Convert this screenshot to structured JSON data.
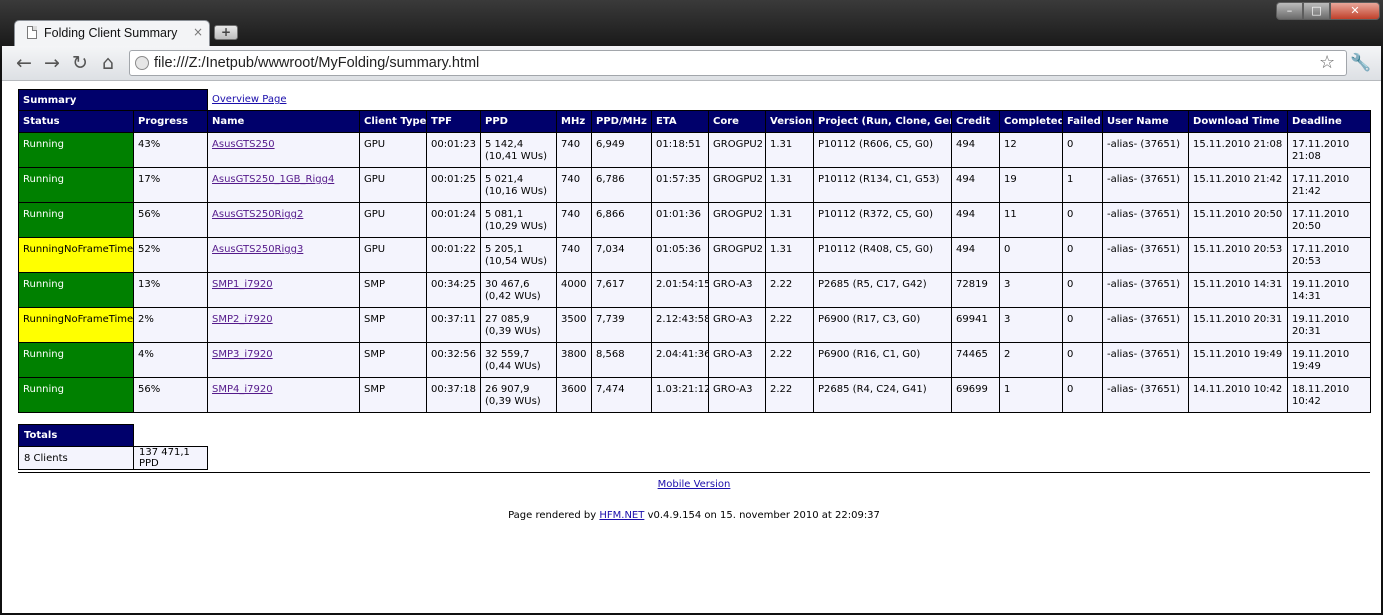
{
  "browser": {
    "tab_title": "Folding Client Summary",
    "tab_close": "×",
    "new_tab": "+",
    "url": "file:///Z:/Inetpub/wwwroot/MyFolding/summary.html",
    "win_min": "–",
    "win_max": "□",
    "win_close": "✕"
  },
  "page": {
    "summary_title": "Summary",
    "overview_link": "Overview Page",
    "columns": [
      "Status",
      "Progress",
      "Name",
      "Client Type",
      "TPF",
      "PPD",
      "MHz",
      "PPD/MHz",
      "ETA",
      "Core",
      "Version",
      "Project (Run, Clone, Gen)",
      "Credit",
      "Completed",
      "Failed",
      "User Name",
      "Download Time",
      "Deadline"
    ],
    "rows": [
      {
        "status": "Running",
        "status_color": "#008000",
        "progress": "43%",
        "name": "AsusGTS250",
        "client_type": "GPU",
        "tpf": "00:01:23",
        "ppd": "5 142,4 (10,41 WUs)",
        "mhz": "740",
        "ppd_mhz": "6,949",
        "eta": "01:18:51",
        "core": "GROGPU2",
        "version": "1.31",
        "project": "P10112 (R606, C5, G0)",
        "credit": "494",
        "completed": "12",
        "failed": "0",
        "user": "-alias- (37651)",
        "download": "15.11.2010 21:08",
        "deadline": "17.11.2010 21:08"
      },
      {
        "status": "Running",
        "status_color": "#008000",
        "progress": "17%",
        "name": "AsusGTS250_1GB_Rigg4",
        "client_type": "GPU",
        "tpf": "00:01:25",
        "ppd": "5 021,4 (10,16 WUs)",
        "mhz": "740",
        "ppd_mhz": "6,786",
        "eta": "01:57:35",
        "core": "GROGPU2",
        "version": "1.31",
        "project": "P10112 (R134, C1, G53)",
        "credit": "494",
        "completed": "19",
        "failed": "1",
        "user": "-alias- (37651)",
        "download": "15.11.2010 21:42",
        "deadline": "17.11.2010 21:42"
      },
      {
        "status": "Running",
        "status_color": "#008000",
        "progress": "56%",
        "name": "AsusGTS250Rigg2",
        "client_type": "GPU",
        "tpf": "00:01:24",
        "ppd": "5 081,1 (10,29 WUs)",
        "mhz": "740",
        "ppd_mhz": "6,866",
        "eta": "01:01:36",
        "core": "GROGPU2",
        "version": "1.31",
        "project": "P10112 (R372, C5, G0)",
        "credit": "494",
        "completed": "11",
        "failed": "0",
        "user": "-alias- (37651)",
        "download": "15.11.2010 20:50",
        "deadline": "17.11.2010 20:50"
      },
      {
        "status": "RunningNoFrameTimes",
        "status_color": "#ffff00",
        "progress": "52%",
        "name": "AsusGTS250Rigg3",
        "client_type": "GPU",
        "tpf": "00:01:22",
        "ppd": "5 205,1 (10,54 WUs)",
        "mhz": "740",
        "ppd_mhz": "7,034",
        "eta": "01:05:36",
        "core": "GROGPU2",
        "version": "1.31",
        "project": "P10112 (R408, C5, G0)",
        "credit": "494",
        "completed": "0",
        "failed": "0",
        "user": "-alias- (37651)",
        "download": "15.11.2010 20:53",
        "deadline": "17.11.2010 20:53"
      },
      {
        "status": "Running",
        "status_color": "#008000",
        "progress": "13%",
        "name": "SMP1_i7920",
        "client_type": "SMP",
        "tpf": "00:34:25",
        "ppd": "30 467,6 (0,42 WUs)",
        "mhz": "4000",
        "ppd_mhz": "7,617",
        "eta": "2.01:54:15",
        "core": "GRO-A3",
        "version": "2.22",
        "project": "P2685 (R5, C17, G42)",
        "credit": "72819",
        "completed": "3",
        "failed": "0",
        "user": "-alias- (37651)",
        "download": "15.11.2010 14:31",
        "deadline": "19.11.2010 14:31"
      },
      {
        "status": "RunningNoFrameTimes",
        "status_color": "#ffff00",
        "progress": "2%",
        "name": "SMP2_i7920",
        "client_type": "SMP",
        "tpf": "00:37:11",
        "ppd": "27 085,9 (0,39 WUs)",
        "mhz": "3500",
        "ppd_mhz": "7,739",
        "eta": "2.12:43:58",
        "core": "GRO-A3",
        "version": "2.22",
        "project": "P6900 (R17, C3, G0)",
        "credit": "69941",
        "completed": "3",
        "failed": "0",
        "user": "-alias- (37651)",
        "download": "15.11.2010 20:31",
        "deadline": "19.11.2010 20:31"
      },
      {
        "status": "Running",
        "status_color": "#008000",
        "progress": "4%",
        "name": "SMP3_i7920",
        "client_type": "SMP",
        "tpf": "00:32:56",
        "ppd": "32 559,7 (0,44 WUs)",
        "mhz": "3800",
        "ppd_mhz": "8,568",
        "eta": "2.04:41:36",
        "core": "GRO-A3",
        "version": "2.22",
        "project": "P6900 (R16, C1, G0)",
        "credit": "74465",
        "completed": "2",
        "failed": "0",
        "user": "-alias- (37651)",
        "download": "15.11.2010 19:49",
        "deadline": "19.11.2010 19:49"
      },
      {
        "status": "Running",
        "status_color": "#008000",
        "progress": "56%",
        "name": "SMP4_i7920",
        "client_type": "SMP",
        "tpf": "00:37:18",
        "ppd": "26 907,9 (0,39 WUs)",
        "mhz": "3600",
        "ppd_mhz": "7,474",
        "eta": "1.03:21:12",
        "core": "GRO-A3",
        "version": "2.22",
        "project": "P2685 (R4, C24, G41)",
        "credit": "69699",
        "completed": "1",
        "failed": "0",
        "user": "-alias- (37651)",
        "download": "14.11.2010 10:42",
        "deadline": "18.11.2010 10:42"
      }
    ],
    "totals_title": "Totals",
    "totals_clients": "8 Clients",
    "totals_ppd": "137 471,1 PPD",
    "mobile_link": "Mobile Version",
    "rendered_prefix": "Page rendered by",
    "rendered_link": "HFM.NET",
    "rendered_suffix": "v0.4.9.154 on 15. november 2010 at 22:09:37"
  }
}
